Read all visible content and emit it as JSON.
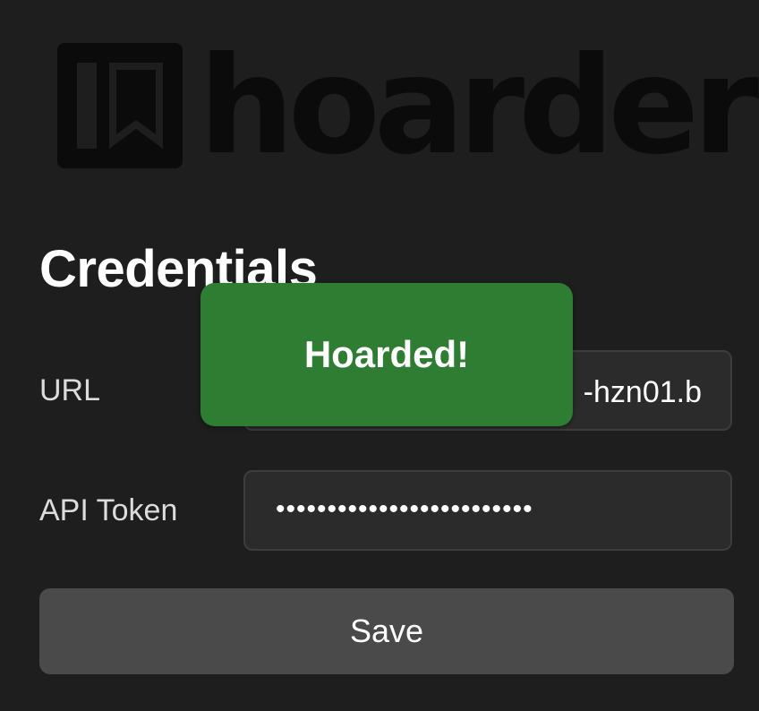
{
  "brand": {
    "name": "hoarder",
    "icon": "bookmark-logo-icon",
    "color": "#0b0b0b"
  },
  "heading": "Credentials",
  "form": {
    "url_label": "URL",
    "url_value": "-hzn01.b",
    "token_label": "API Token",
    "token_value": "•••••••••••••••••••••••••"
  },
  "save_label": "Save",
  "toast": {
    "message": "Hoarded!",
    "color": "#2e7d32"
  },
  "colors": {
    "background": "#1e1e1e",
    "input_background": "#2b2b2b",
    "button_background": "#4a4a4a"
  }
}
